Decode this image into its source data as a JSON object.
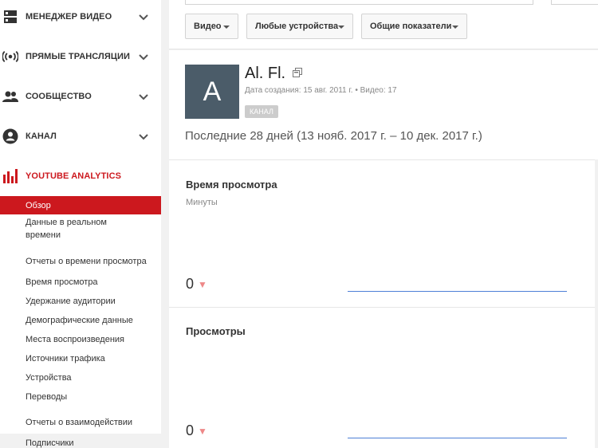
{
  "sidebar": {
    "nav": [
      {
        "label": "Менеджер видео",
        "icon": "video-manager-icon"
      },
      {
        "label": "Прямые трансляции",
        "icon": "live-stream-icon"
      },
      {
        "label": "Сообщество",
        "icon": "community-icon"
      },
      {
        "label": "Канал",
        "icon": "channel-icon"
      },
      {
        "label": "YouTube Analytics",
        "icon": "analytics-icon"
      }
    ],
    "overview": "Обзор",
    "realtime_line1": "Данные в реальном",
    "realtime_line2": "времени",
    "watch_reports_heading": "Отчеты о времени просмотра",
    "watch_reports": [
      "Время просмотра",
      "Удержание аудитории",
      "Демографические данные",
      "Места воспроизведения",
      "Источники трафика",
      "Устройства",
      "Переводы"
    ],
    "interaction_heading": "Отчеты о взаимодействии",
    "subscribers": "Подписчики"
  },
  "filters": {
    "content": "Видео",
    "devices": "Любые устройства",
    "metrics": "Общие показатели"
  },
  "channel": {
    "avatar_letter": "A",
    "name": "Al. Fl.",
    "meta": "Дата создания: 15 авг. 2011 г.  •  Видео: 17",
    "badge": "КАНАЛ",
    "period": "Последние 28 дней (13 нояб. 2017 г. – 10 дек. 2017 г.)"
  },
  "metrics": [
    {
      "title": "Время просмотра",
      "unit": "Минуты",
      "value": "0",
      "trend": "▼"
    },
    {
      "title": "Просмотры",
      "value": "0",
      "trend": "▼"
    }
  ],
  "colors": {
    "accent_red": "#cc181e",
    "avatar_bg": "#4b5c69",
    "spark_line": "#4d7fd6",
    "trend_down": "#ee8888"
  }
}
